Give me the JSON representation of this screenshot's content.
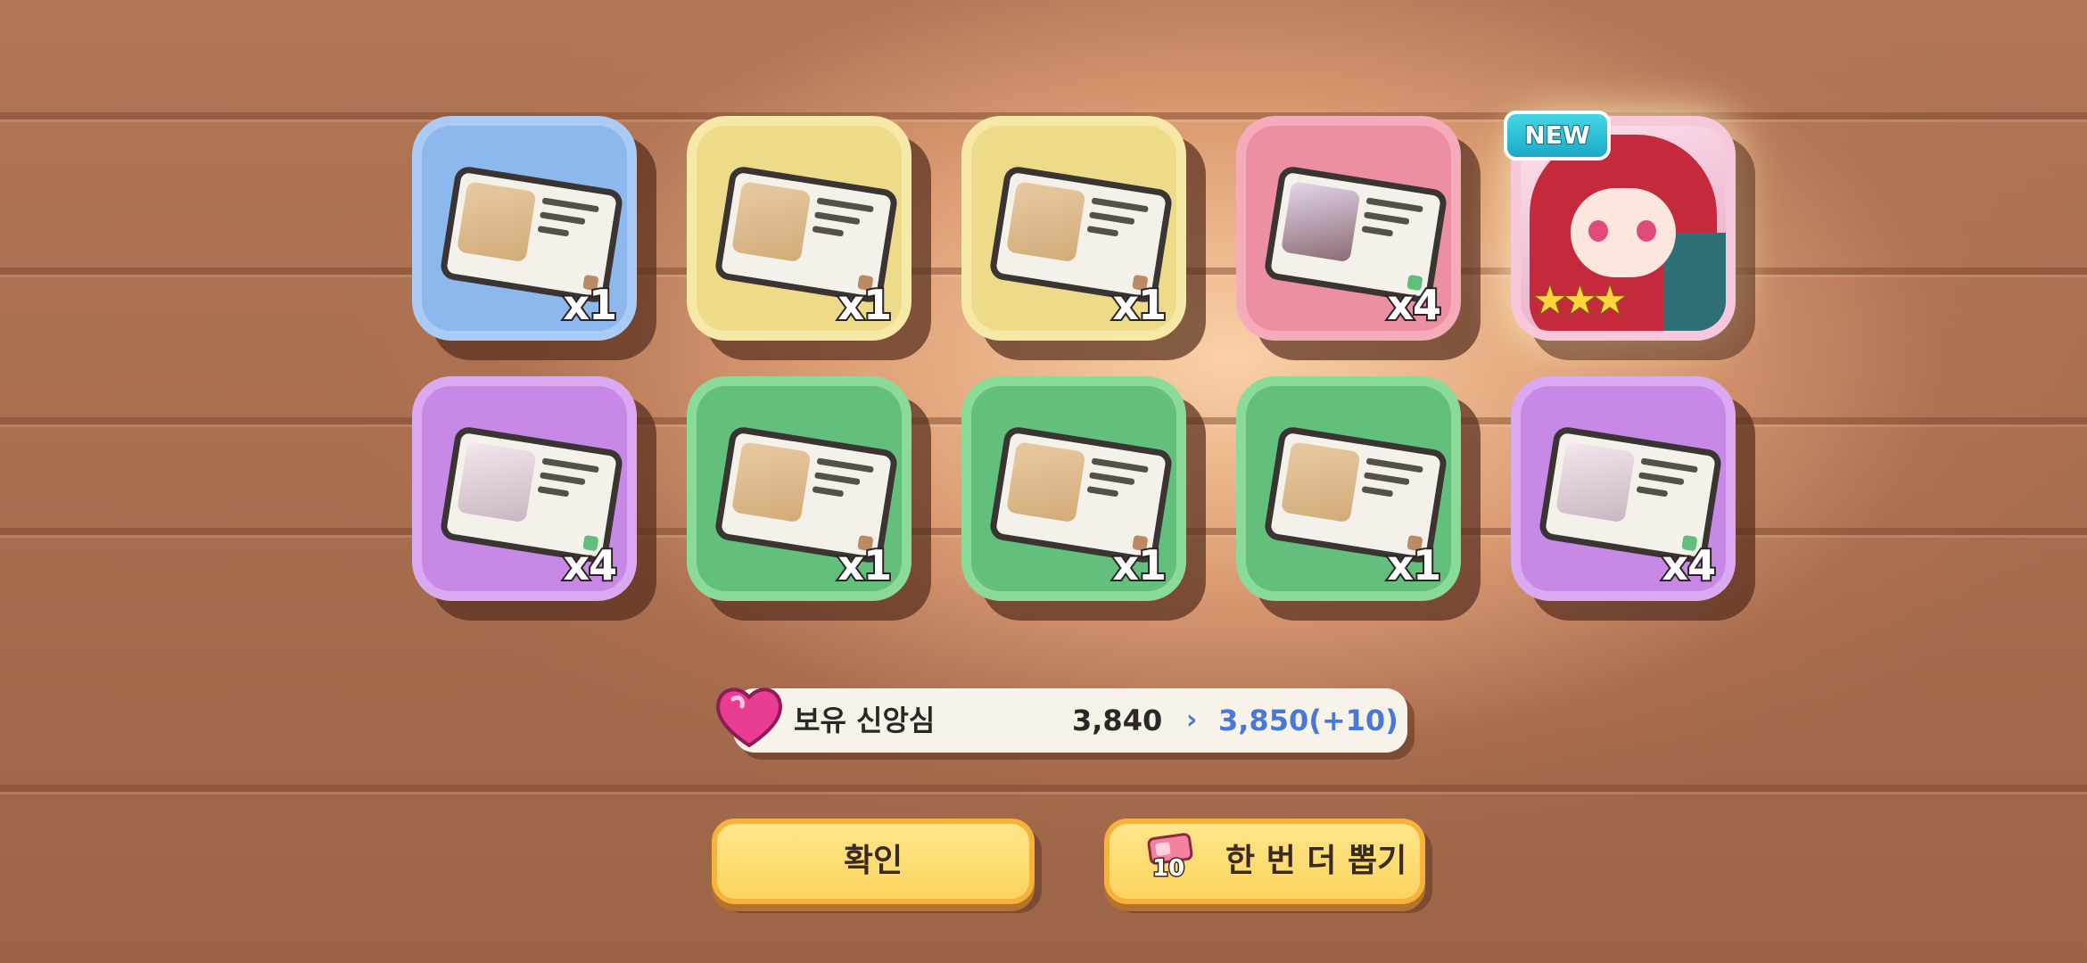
{
  "rewards": [
    {
      "color": "blue",
      "icon": "sprout-card-icon",
      "qty": "x1"
    },
    {
      "color": "yellow",
      "icon": "sprout-card-icon",
      "qty": "x1"
    },
    {
      "color": "yellow",
      "icon": "sprout-card-icon",
      "qty": "x1"
    },
    {
      "color": "pink",
      "icon": "character-card-icon",
      "qty": "x4"
    },
    {
      "color": "pink",
      "icon": "character-portrait",
      "badge": "NEW",
      "stars": 3
    },
    {
      "color": "purple",
      "icon": "character-card-icon",
      "qty": "x4"
    },
    {
      "color": "green",
      "icon": "sprout-card-icon",
      "qty": "x1"
    },
    {
      "color": "green",
      "icon": "sprout-card-icon",
      "qty": "x1"
    },
    {
      "color": "green",
      "icon": "sprout-card-icon",
      "qty": "x1"
    },
    {
      "color": "purple",
      "icon": "character-card-icon",
      "qty": "x4"
    }
  ],
  "hero": {
    "badge": "NEW",
    "stars": "★★★"
  },
  "faith": {
    "label": "보유 신앙심",
    "current": "3,840",
    "arrow": "›",
    "new_value": "3,850(+10)",
    "icon": "heart-gem-icon"
  },
  "buttons": {
    "confirm": "확인",
    "again": "한 번 더 뽑기",
    "ticket_count": "10"
  },
  "colors": {
    "blue": "#8db8ee",
    "yellow": "#eedb8a",
    "pink": "#ec8fa2",
    "purple": "#c889e6",
    "green": "#63bf7c",
    "accent_value": "#4a78d6",
    "button_fill": "#fbd45e"
  }
}
